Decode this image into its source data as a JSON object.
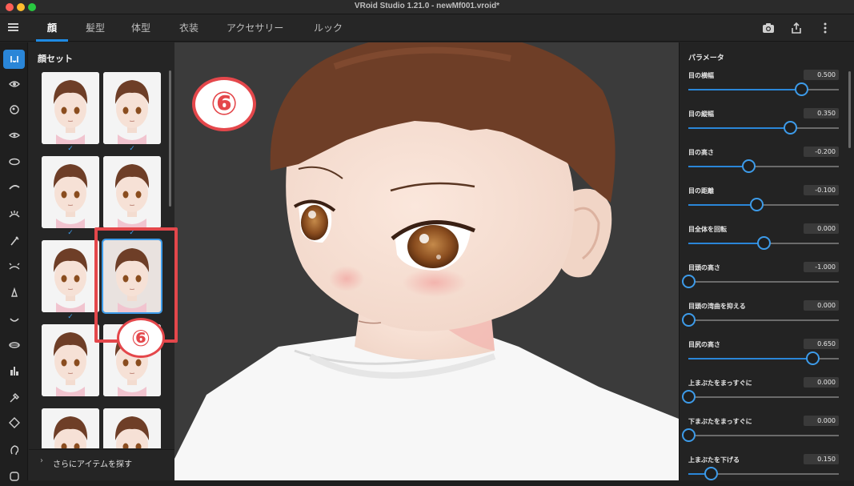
{
  "window": {
    "title": "VRoid Studio 1.21.0 - newMf001.vroid*"
  },
  "tabs": [
    {
      "label": "顔",
      "active": true
    },
    {
      "label": "髪型"
    },
    {
      "label": "体型"
    },
    {
      "label": "衣装"
    },
    {
      "label": "アクセサリー"
    },
    {
      "label": "ルック"
    }
  ],
  "toolbar": {
    "camera": "camera-icon",
    "export": "export-icon",
    "more": "more-vertical-icon"
  },
  "rail": {
    "items": [
      "face-set-icon",
      "eye-icon",
      "iris-icon",
      "eye-highlight-icon",
      "eye-white-icon",
      "eyebrow-icon",
      "eyelash-icon",
      "eyeliner-icon",
      "eyelid-icon",
      "nose-icon",
      "mouth-icon",
      "teeth-icon",
      "face-shape-icon",
      "brush-icon",
      "ear-icon",
      "head-icon",
      "misc-icon"
    ]
  },
  "face_panel": {
    "title": "顔セット",
    "more_label": "さらにアイテムを探す",
    "selected_index": 5,
    "checked_indices": [
      0,
      1,
      2,
      3,
      4
    ]
  },
  "callouts": {
    "main": "⑥",
    "thumb": "⑥"
  },
  "accent_color": "#2a86d8",
  "callout_color": "#e4474b",
  "params": {
    "title": "パラメータ",
    "items": [
      {
        "label": "目の横幅",
        "value": "0.500",
        "level": 0.75
      },
      {
        "label": "目の縦幅",
        "value": "0.350",
        "level": 0.675
      },
      {
        "label": "目の高さ",
        "value": "-0.200",
        "level": 0.4
      },
      {
        "label": "目の距離",
        "value": "-0.100",
        "level": 0.45
      },
      {
        "label": "目全体を回転",
        "value": "0.000",
        "level": 0.5
      },
      {
        "label": "目頭の高さ",
        "value": "-1.000",
        "level": 0.0
      },
      {
        "label": "目頭の湾曲を抑える",
        "value": "0.000",
        "level": 0.0
      },
      {
        "label": "目尻の高さ",
        "value": "0.650",
        "level": 0.825
      },
      {
        "label": "上まぶたをまっすぐに",
        "value": "0.000",
        "level": 0.0
      },
      {
        "label": "下まぶたをまっすぐに",
        "value": "0.000",
        "level": 0.0
      },
      {
        "label": "上まぶたを下げる",
        "value": "0.150",
        "level": 0.15
      }
    ]
  }
}
